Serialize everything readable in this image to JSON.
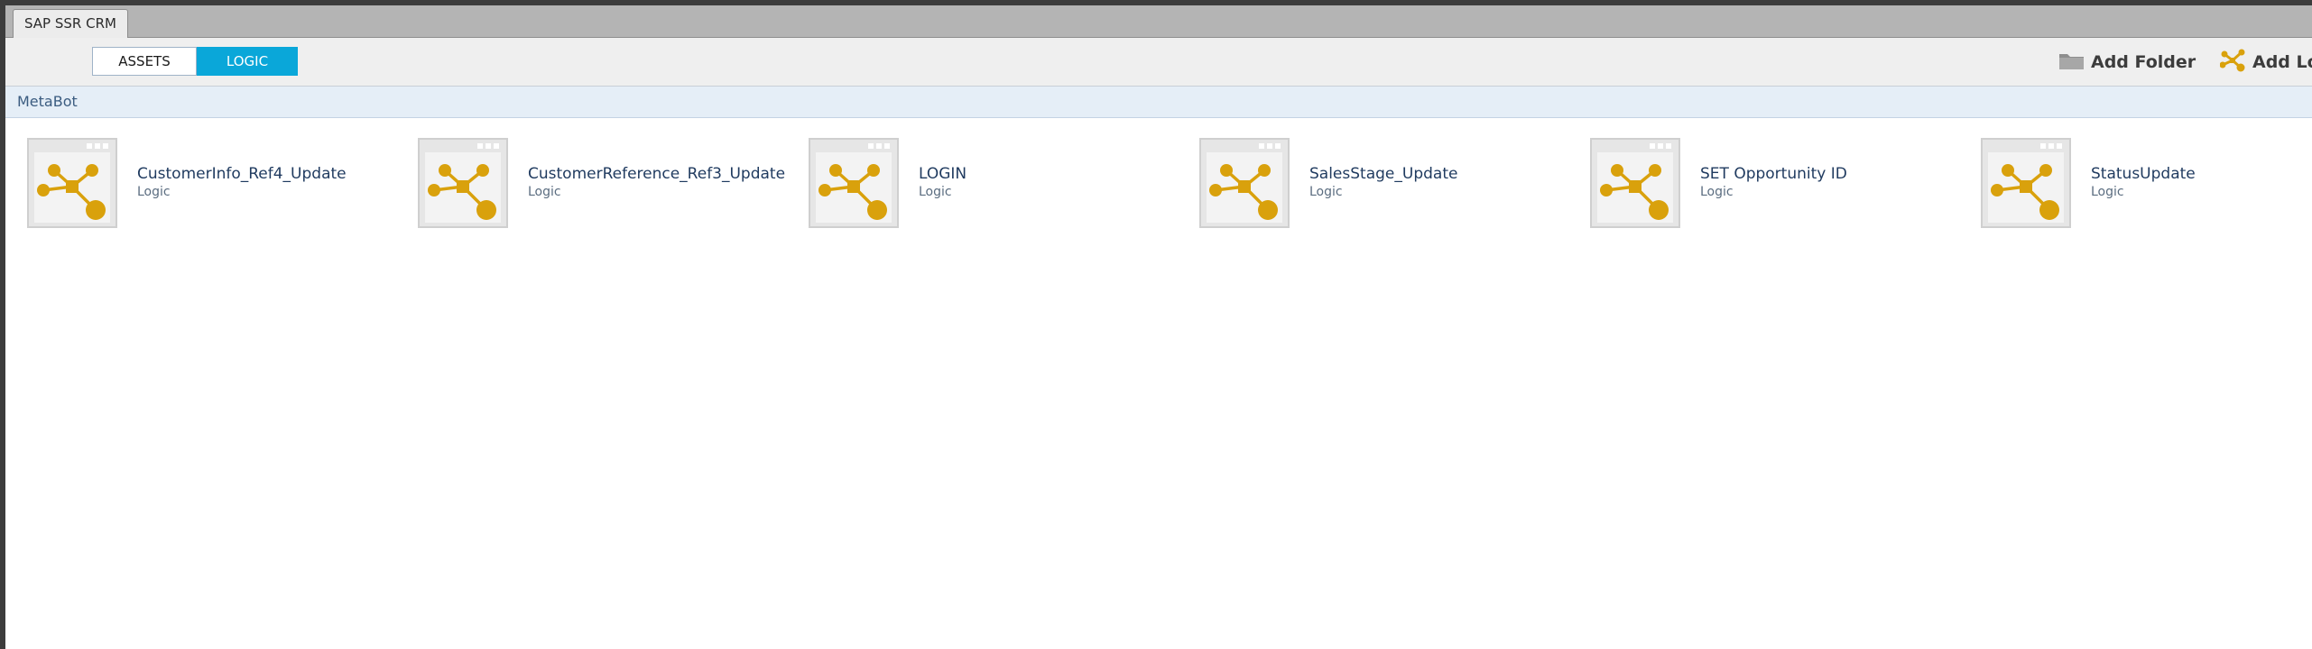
{
  "window": {
    "tab_title": "SAP SSR CRM"
  },
  "toolbar": {
    "segments": [
      {
        "label": "ASSETS",
        "selected": false
      },
      {
        "label": "LOGIC",
        "selected": true
      }
    ],
    "add_folder_label": "Add Folder",
    "add_logic_label": "Add Lo"
  },
  "breadcrumb": {
    "label": "MetaBot"
  },
  "items": [
    {
      "name": "CustomerInfo_Ref4_Update",
      "type": "Logic"
    },
    {
      "name": "CustomerReference_Ref3_Update",
      "type": "Logic"
    },
    {
      "name": "LOGIN",
      "type": "Logic"
    },
    {
      "name": "SalesStage_Update",
      "type": "Logic"
    },
    {
      "name": "SET Opportunity ID",
      "type": "Logic"
    },
    {
      "name": "StatusUpdate",
      "type": "Logic"
    }
  ],
  "colors": {
    "accent": "#0aa7d9",
    "logic_icon": "#d9a10c",
    "breadcrumb_bg": "#e5eef7"
  },
  "icons": {
    "logic": "logic-nodes-icon",
    "folder": "folder-icon",
    "add_logic": "add-logic-icon"
  }
}
